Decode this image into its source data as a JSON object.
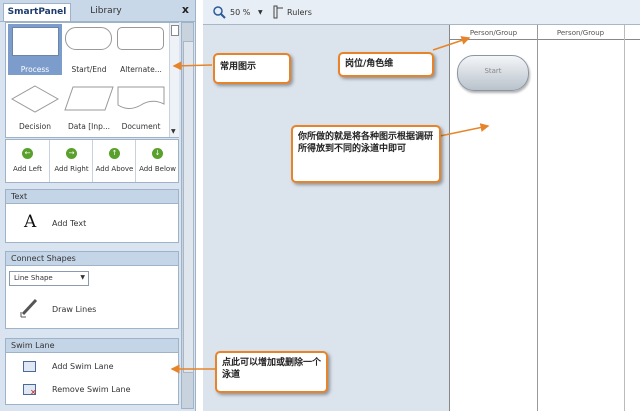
{
  "panel": {
    "tabs": [
      {
        "label": "SmartPanel"
      },
      {
        "label": "Library"
      }
    ],
    "close": "x",
    "shapes": [
      {
        "label": "Process"
      },
      {
        "label": "Start/End"
      },
      {
        "label": "Alternate..."
      },
      {
        "label": "Decision"
      },
      {
        "label": "Data [Inp..."
      },
      {
        "label": "Document"
      }
    ],
    "add_buttons": [
      {
        "label": "Add Left",
        "arrow": "←"
      },
      {
        "label": "Add Right",
        "arrow": "→"
      },
      {
        "label": "Add Above",
        "arrow": "↑"
      },
      {
        "label": "Add Below",
        "arrow": "↓"
      }
    ],
    "text_section": {
      "header": "Text",
      "glyph": "A",
      "item": "Add Text"
    },
    "connect_section": {
      "header": "Connect Shapes",
      "select_value": "Line Shape",
      "item": "Draw Lines"
    },
    "swim_section": {
      "header": "Swim Lane",
      "add": "Add Swim Lane",
      "remove": "Remove Swim Lane"
    }
  },
  "toolbar": {
    "zoom": "50 %",
    "rulers": "Rulers"
  },
  "canvas": {
    "lanes": [
      {
        "label": "Person/Group"
      },
      {
        "label": "Person/Group"
      }
    ],
    "start_shape": "Start"
  },
  "callouts": {
    "common_shapes": "常用图示",
    "position_dimension": "岗位/角色维",
    "place_shapes": "你所做的就是将各种图示根据调研所得放到不同的泳道中即可",
    "add_delete_lane": "点此可以增加或删除一个泳道"
  },
  "colors": {
    "accent": "#e7842a",
    "panel": "#d9e4f0",
    "selected": "#7c9ccc",
    "green": "#5aa02c"
  }
}
